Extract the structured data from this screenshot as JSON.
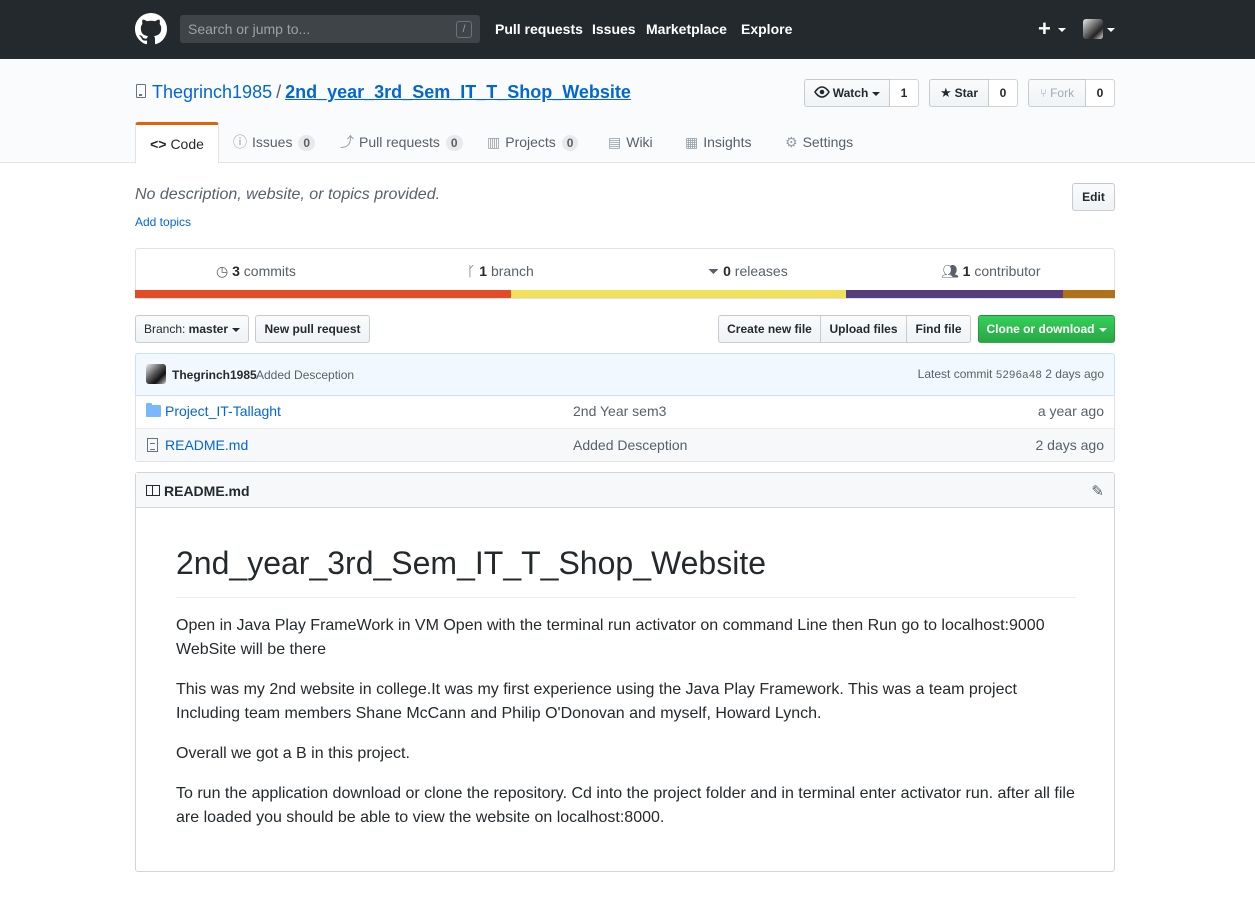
{
  "header": {
    "search_placeholder": "Search or jump to...",
    "search_shortcut": "/",
    "nav": [
      "Pull requests",
      "Issues",
      "Marketplace",
      "Explore"
    ],
    "plus": "+"
  },
  "repo": {
    "owner": "Thegrinch1985",
    "separator": "/",
    "name": "2nd_year_3rd_Sem_IT_T_Shop_Website",
    "watch_label": "Watch",
    "watch_count": "1",
    "star_label": "Star",
    "star_count": "0",
    "fork_label": "Fork",
    "fork_count": "0"
  },
  "tabs": [
    {
      "icon": "<>",
      "label": "Code"
    },
    {
      "icon": "ⓘ",
      "label": "Issues",
      "count": "0"
    },
    {
      "icon": "⤴",
      "label": "Pull requests",
      "count": "0"
    },
    {
      "icon": "▥",
      "label": "Projects",
      "count": "0"
    },
    {
      "icon": "▤",
      "label": "Wiki"
    },
    {
      "icon": "▦",
      "label": "Insights"
    },
    {
      "icon": "⚙",
      "label": "Settings"
    }
  ],
  "description": {
    "text": "No description, website, or topics provided.",
    "add_topics": "Add topics",
    "edit": "Edit"
  },
  "summary": {
    "commits_count": "3",
    "commits_label": "commits",
    "branch_count": "1",
    "branch_label": "branch",
    "releases_count": "0",
    "releases_label": "releases",
    "contributor_count": "1",
    "contributor_label": "contributor",
    "language_colors": [
      "#e34c26",
      "#f1e05a",
      "#563d7c",
      "#b07219"
    ],
    "language_shares": [
      0.384,
      0.342,
      0.221,
      0.053
    ]
  },
  "file_nav": {
    "branch_prefix": "Branch:",
    "branch_name": "master",
    "new_pull_request": "New pull request",
    "create_new_file": "Create new file",
    "upload_files": "Upload files",
    "find_file": "Find file",
    "clone": "Clone or download"
  },
  "commit": {
    "author": "Thegrinch1985",
    "message": "Added Desception",
    "latest_label": "Latest commit",
    "sha": "5296a48",
    "age": "2 days ago"
  },
  "files": [
    {
      "type": "folder",
      "name": "Project_IT-Tallaght",
      "message": "2nd Year sem3",
      "age": "a year ago"
    },
    {
      "type": "file",
      "name": "README.md",
      "message": "Added Desception",
      "age": "2 days ago"
    }
  ],
  "readme": {
    "filename": "README.md",
    "heading": "2nd_year_3rd_Sem_IT_T_Shop_Website",
    "paragraphs": [
      "Open in Java Play FrameWork in VM Open with the terminal run activator on command Line then Run go to localhost:9000 WebSite will be there",
      "This was my 2nd website in college.It was my first experience using the Java Play Framework. This was a team project Including team members Shane McCann and Philip O'Donovan and myself, Howard Lynch.",
      "Overall we got a B in this project.",
      "To run the application download or clone the repository. Cd into the project folder and in terminal enter activator run. after all file are loaded you should be able to view the website on localhost:8000."
    ]
  }
}
